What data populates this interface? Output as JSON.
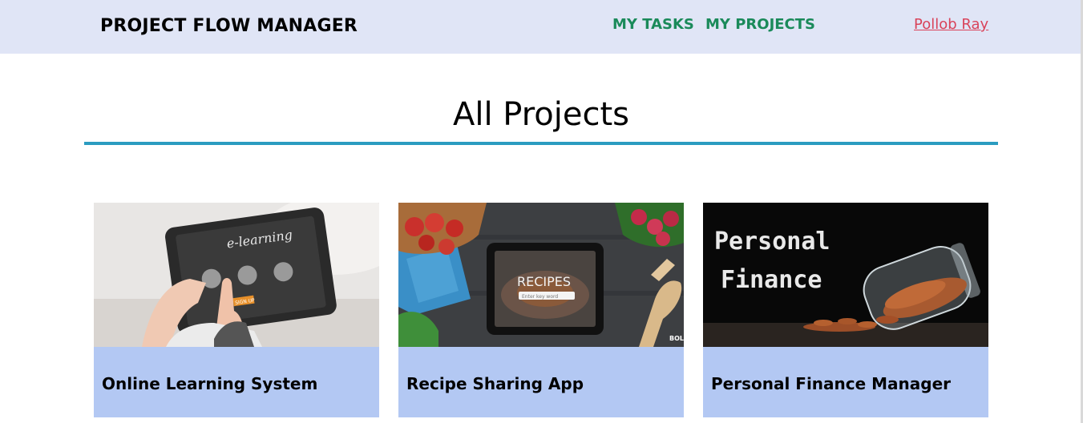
{
  "navbar": {
    "brand": "PROJECT FLOW MANAGER",
    "links": [
      "MY TASKS",
      "MY PROJECTS"
    ],
    "user": "Pollob Ray"
  },
  "main": {
    "title": "All Projects"
  },
  "projects": [
    {
      "title": "Online Learning System",
      "image_text": [
        "e-learning",
        "SIGN UP"
      ]
    },
    {
      "title": "Recipe Sharing App",
      "image_text": [
        "RECIPES",
        "Enter key word",
        "BOL"
      ]
    },
    {
      "title": "Personal Finance Manager",
      "image_text": [
        "Personal",
        "Finance"
      ]
    }
  ],
  "colors": {
    "navbar_bg": "#e0e5f6",
    "nav_link": "#1a8a5a",
    "user_link": "#d9435a",
    "title_rule": "#2b9cc0",
    "card_body": "#b3c8f3"
  }
}
